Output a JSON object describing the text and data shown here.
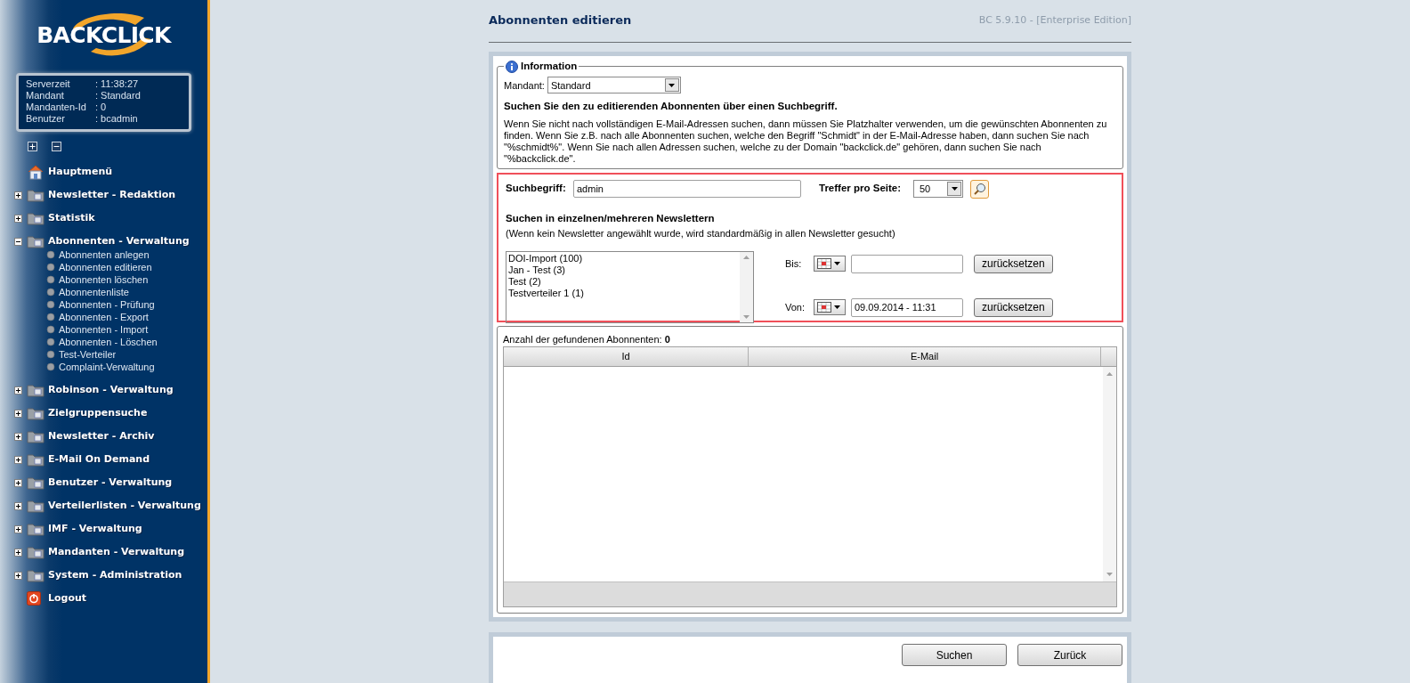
{
  "sidebar": {
    "logo": "BACKCLICK",
    "server_info": [
      {
        "label": "Serverzeit",
        "value": ":  11:38:27"
      },
      {
        "label": "Mandant",
        "value": ": Standard"
      },
      {
        "label": "Mandanten-Id",
        "value": ": 0"
      },
      {
        "label": "Benutzer",
        "value": ": bcadmin"
      }
    ],
    "menu": [
      {
        "kind": "home",
        "label": "Hauptmenü"
      },
      {
        "kind": "folder",
        "label": "Newsletter - Redaktion",
        "expanded": false
      },
      {
        "kind": "folder",
        "label": "Statistik",
        "expanded": false
      },
      {
        "kind": "folder",
        "label": "Abonnenten - Verwaltung",
        "expanded": true,
        "children": [
          {
            "label": "Abonnenten anlegen"
          },
          {
            "label": "Abonnenten editieren"
          },
          {
            "label": "Abonnenten löschen"
          },
          {
            "label": "Abonnentenliste"
          },
          {
            "label": "Abonnenten - Prüfung"
          },
          {
            "label": "Abonnenten - Export"
          },
          {
            "label": "Abonnenten - Import"
          },
          {
            "label": "Abonnenten - Löschen"
          },
          {
            "label": "Test-Verteiler"
          },
          {
            "label": "Complaint-Verwaltung"
          }
        ]
      },
      {
        "kind": "folder",
        "label": "Robinson - Verwaltung",
        "expanded": false
      },
      {
        "kind": "folder",
        "label": "Zielgruppensuche",
        "expanded": false
      },
      {
        "kind": "folder",
        "label": "Newsletter - Archiv",
        "expanded": false
      },
      {
        "kind": "folder",
        "label": "E-Mail On Demand",
        "expanded": false
      },
      {
        "kind": "folder",
        "label": "Benutzer - Verwaltung",
        "expanded": false
      },
      {
        "kind": "folder",
        "label": "Verteilerlisten - Verwaltung",
        "expanded": false
      },
      {
        "kind": "folder",
        "label": "IMF - Verwaltung",
        "expanded": false
      },
      {
        "kind": "folder",
        "label": "Mandanten - Verwaltung",
        "expanded": false
      },
      {
        "kind": "folder",
        "label": "System - Administration",
        "expanded": false
      },
      {
        "kind": "logout",
        "label": "Logout"
      }
    ]
  },
  "page_title": "Abonnenten editieren",
  "version": "BC 5.9.10 - [Enterprise Edition]",
  "information": {
    "legend": "Information",
    "mandant_label": "Mandant:",
    "mandant_value": "Standard",
    "heading": "Suchen Sie den zu editierenden Abonnenten über einen Suchbegriff.",
    "text": "Wenn Sie nicht nach vollständigen E-Mail-Adressen suchen, dann müssen Sie Platzhalter verwenden, um die gewünschten Abonnenten zu finden. Wenn Sie z.B. nach alle Abonnenten suchen, welche den Begriff \"Schmidt\" in der E-Mail-Adresse haben, dann suchen Sie nach \"%schmidt%\". Wenn Sie nach allen Adressen suchen, welche zu der Domain \"backclick.de\" gehören, dann suchen Sie nach \"%backclick.de\"."
  },
  "search": {
    "term_label": "Suchbegriff:",
    "term_value": "admin",
    "per_page_label": "Treffer pro Seite:",
    "per_page_value": "50",
    "newsletter_heading": "Suchen in einzelnen/mehreren Newslettern",
    "newsletter_hint": "(Wenn kein Newsletter angewählt wurde, wird standardmäßig in allen Newsletter gesucht)",
    "newsletters": [
      {
        "label": "DOI-Import (100)",
        "selected": false
      },
      {
        "label": "Jan - Test (3)",
        "selected": false
      },
      {
        "label": "Test (2)",
        "selected": false
      },
      {
        "label": "Testverteiler 1 (1)",
        "selected": false
      }
    ],
    "bis_label": "Bis:",
    "bis_reset": "zurücksetzen",
    "von_label": "Von:",
    "von_value": "09.09.2014 - 11:31",
    "von_reset": "zurücksetzen"
  },
  "results": {
    "count_label": "Anzahl der gefundenen Abonnenten:",
    "count": "0",
    "columns": [
      "Id",
      "E-Mail"
    ]
  },
  "buttons": [
    "Suchen",
    "Zurück"
  ]
}
